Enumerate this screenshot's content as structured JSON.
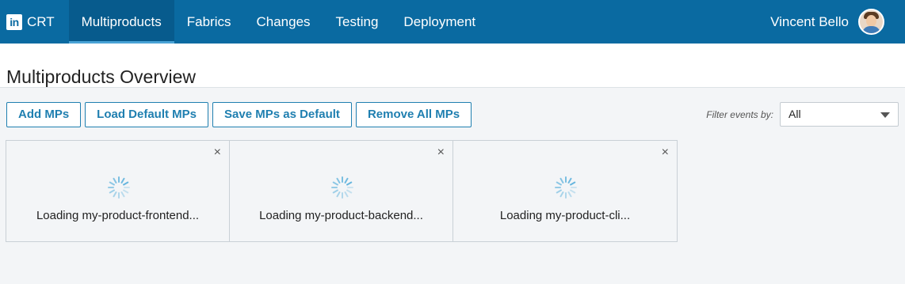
{
  "header": {
    "app_name": "CRT",
    "nav": [
      {
        "label": "Multiproducts",
        "active": true
      },
      {
        "label": "Fabrics",
        "active": false
      },
      {
        "label": "Changes",
        "active": false
      },
      {
        "label": "Testing",
        "active": false
      },
      {
        "label": "Deployment",
        "active": false
      }
    ],
    "user_name": "Vincent Bello",
    "icons": {
      "logo": "linkedin-logo-icon",
      "avatar": "user-avatar"
    }
  },
  "page": {
    "title": "Multiproducts Overview"
  },
  "toolbar": {
    "add_label": "Add MPs",
    "load_default_label": "Load Default MPs",
    "save_default_label": "Save MPs as Default",
    "remove_all_label": "Remove All MPs"
  },
  "filter": {
    "label": "Filter events by:",
    "selected": "All"
  },
  "cards": [
    {
      "loading_text": "Loading my-product-frontend...",
      "close": "×"
    },
    {
      "loading_text": "Loading my-product-backend...",
      "close": "×"
    },
    {
      "loading_text": "Loading my-product-cli...",
      "close": "×"
    }
  ],
  "colors": {
    "header_bg": "#0a6aa1",
    "accent": "#1f7fb0",
    "spinner": "#5fb3dd"
  }
}
